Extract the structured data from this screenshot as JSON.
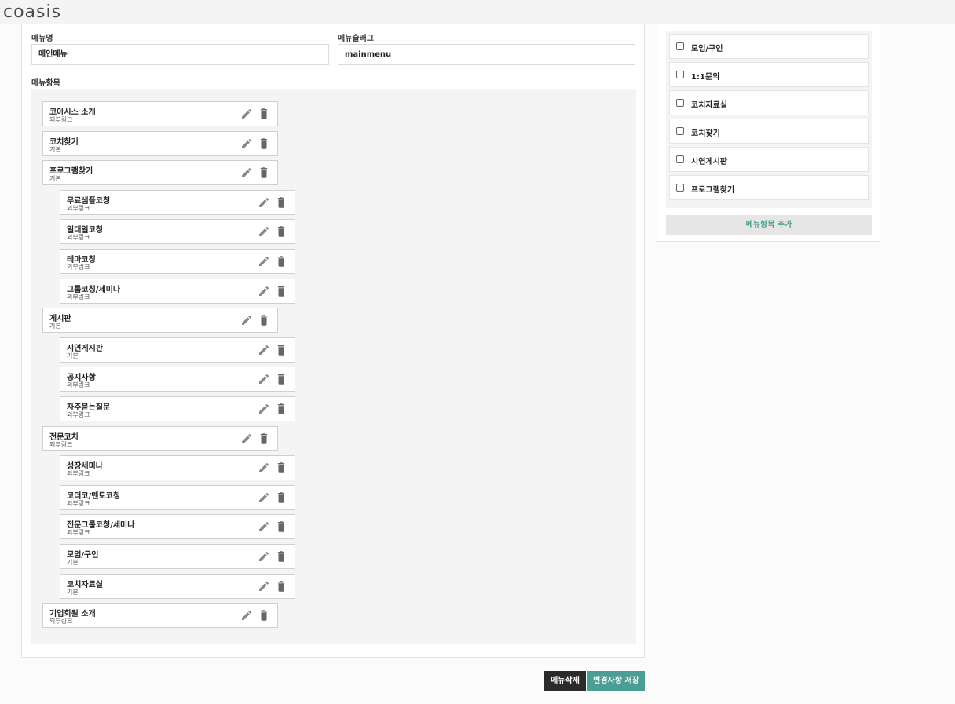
{
  "app": {
    "logo": "coasis"
  },
  "form": {
    "menu_name_label": "메뉴명",
    "menu_name_value": "메인메뉴",
    "menu_slug_label": "메뉴슬러그",
    "menu_slug_value": "mainmenu",
    "items_label": "메뉴항목"
  },
  "menu_items": [
    {
      "title": "코아시스 소개",
      "type": "외부링크",
      "level": 0
    },
    {
      "title": "코치찾기",
      "type": "기본",
      "level": 0
    },
    {
      "title": "프로그램찾기",
      "type": "기본",
      "level": 0
    },
    {
      "title": "무료샘플코칭",
      "type": "외부링크",
      "level": 1
    },
    {
      "title": "일대일코칭",
      "type": "외부링크",
      "level": 1
    },
    {
      "title": "테마코칭",
      "type": "외부링크",
      "level": 1
    },
    {
      "title": "그룹코칭/세미나",
      "type": "외부링크",
      "level": 1
    },
    {
      "title": "게시판",
      "type": "기본",
      "level": 0
    },
    {
      "title": "시연게시판",
      "type": "기본",
      "level": 1
    },
    {
      "title": "공지사항",
      "type": "외부링크",
      "level": 1
    },
    {
      "title": "자주묻는질문",
      "type": "외부링크",
      "level": 1
    },
    {
      "title": "전문코치",
      "type": "외부링크",
      "level": 0
    },
    {
      "title": "성장세미나",
      "type": "외부링크",
      "level": 1
    },
    {
      "title": "코더코/멘토코칭",
      "type": "외부링크",
      "level": 1
    },
    {
      "title": "전문그룹코칭/세미나",
      "type": "외부링크",
      "level": 1
    },
    {
      "title": "모임/구인",
      "type": "기본",
      "level": 1
    },
    {
      "title": "코치자료실",
      "type": "기본",
      "level": 1
    },
    {
      "title": "기업회원 소개",
      "type": "외부링크",
      "level": 0
    }
  ],
  "available_items": [
    {
      "label": "모임/구인",
      "checked": false
    },
    {
      "label": "1:1문의",
      "checked": false
    },
    {
      "label": "코치자료실",
      "checked": false
    },
    {
      "label": "코치찾기",
      "checked": false
    },
    {
      "label": "시연게시판",
      "checked": false
    },
    {
      "label": "프로그램찾기",
      "checked": false
    }
  ],
  "buttons": {
    "add_item": "메뉴항목 추가",
    "delete_menu": "메뉴삭제",
    "save_changes": "변경사항 저장"
  },
  "colors": {
    "accent": "#4a9e94",
    "dark_button": "#2b2b2b",
    "icon_gray": "#666666"
  },
  "icons": {
    "edit": "pencil-icon",
    "delete": "trash-icon"
  }
}
